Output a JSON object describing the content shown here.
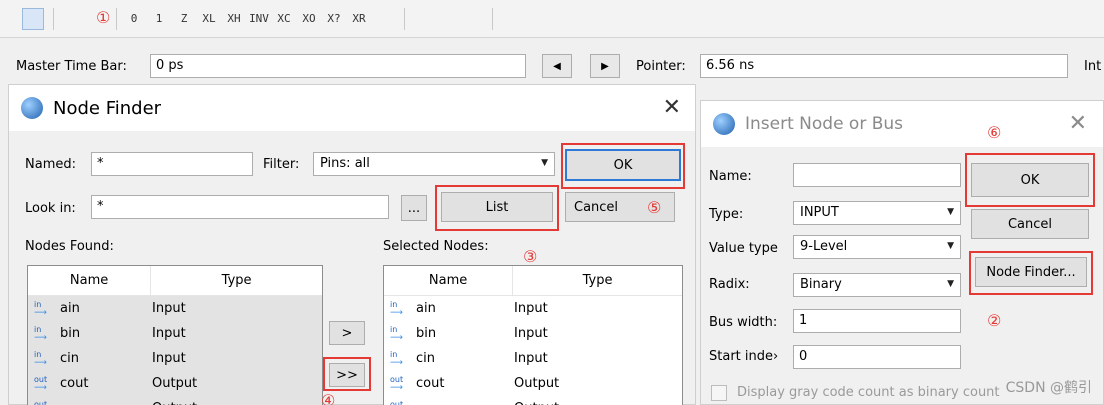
{
  "toolbar": {
    "icons": [
      "pointer-tool-icon",
      "zoom-tool-icon",
      "forcing-tool-icon",
      "force-low-icon",
      "force-high-icon",
      "high-impedance-icon",
      "weak-low-icon",
      "weak-high-icon",
      "invert-icon",
      "count-value-icon",
      "forcing-clock-icon",
      "arbitrary-value-icon",
      "random-value-icon",
      "snap-to-grid-icon",
      "snap-transitions-icon",
      "sort-icon",
      "grid-icon",
      "ungroup-icon"
    ],
    "labels": [
      "",
      "",
      "",
      "0",
      "1",
      "Z",
      "XL",
      "XH",
      "INV",
      "XC",
      "XO",
      "X?",
      "XR",
      "",
      "",
      "",
      "",
      ""
    ]
  },
  "timebar": {
    "master_label": "Master Time Bar:",
    "master_value": "0 ps",
    "prev_label": "◀",
    "next_label": "▶",
    "pointer_label": "Pointer:",
    "pointer_value": "6.56 ns",
    "interval_label": "Int"
  },
  "node_finder": {
    "title": "Node Finder",
    "close": "✕",
    "named_label": "Named:",
    "named_value": "*",
    "filter_label": "Filter:",
    "filter_value": "Pins: all",
    "ok": "OK",
    "lookin_label": "Look in:",
    "lookin_value": "*",
    "browse": "...",
    "list": "List",
    "cancel": "Cancel",
    "nodes_found_label": "Nodes Found:",
    "selected_nodes_label": "Selected Nodes:",
    "col_name": "Name",
    "col_type": "Type",
    "add_one": ">",
    "add_all": ">>",
    "found_rows": [
      {
        "name": "ain",
        "type": "Input",
        "dir": "in"
      },
      {
        "name": "bin",
        "type": "Input",
        "dir": "in"
      },
      {
        "name": "cin",
        "type": "Input",
        "dir": "in"
      },
      {
        "name": "cout",
        "type": "Output",
        "dir": "out"
      },
      {
        "name": "",
        "type": "Output",
        "dir": "out"
      }
    ],
    "selected_rows": [
      {
        "name": "ain",
        "type": "Input",
        "dir": "in"
      },
      {
        "name": "bin",
        "type": "Input",
        "dir": "in"
      },
      {
        "name": "cin",
        "type": "Input",
        "dir": "in"
      },
      {
        "name": "cout",
        "type": "Output",
        "dir": "out"
      },
      {
        "name": "",
        "type": "Output",
        "dir": "out"
      }
    ]
  },
  "insert_node": {
    "title": "Insert Node or Bus",
    "close": "✕",
    "name_label": "Name:",
    "name_value": "",
    "type_label": "Type:",
    "type_value": "INPUT",
    "value_type_label": "Value type",
    "value_type_value": "9-Level",
    "radix_label": "Radix:",
    "radix_value": "Binary",
    "bus_width_label": "Bus width:",
    "bus_width_value": "1",
    "start_index_label": "Start inde›",
    "start_index_value": "0",
    "gray_code_label": "Display gray code count as binary count",
    "ok": "OK",
    "cancel": "Cancel",
    "node_finder_btn": "Node Finder..."
  },
  "annotations": {
    "n1": "①",
    "n2": "②",
    "n3": "③",
    "n4": "④",
    "n5": "⑤",
    "n6": "⑥",
    "color": "#e53935"
  },
  "watermark": "CSDN @鹤引"
}
